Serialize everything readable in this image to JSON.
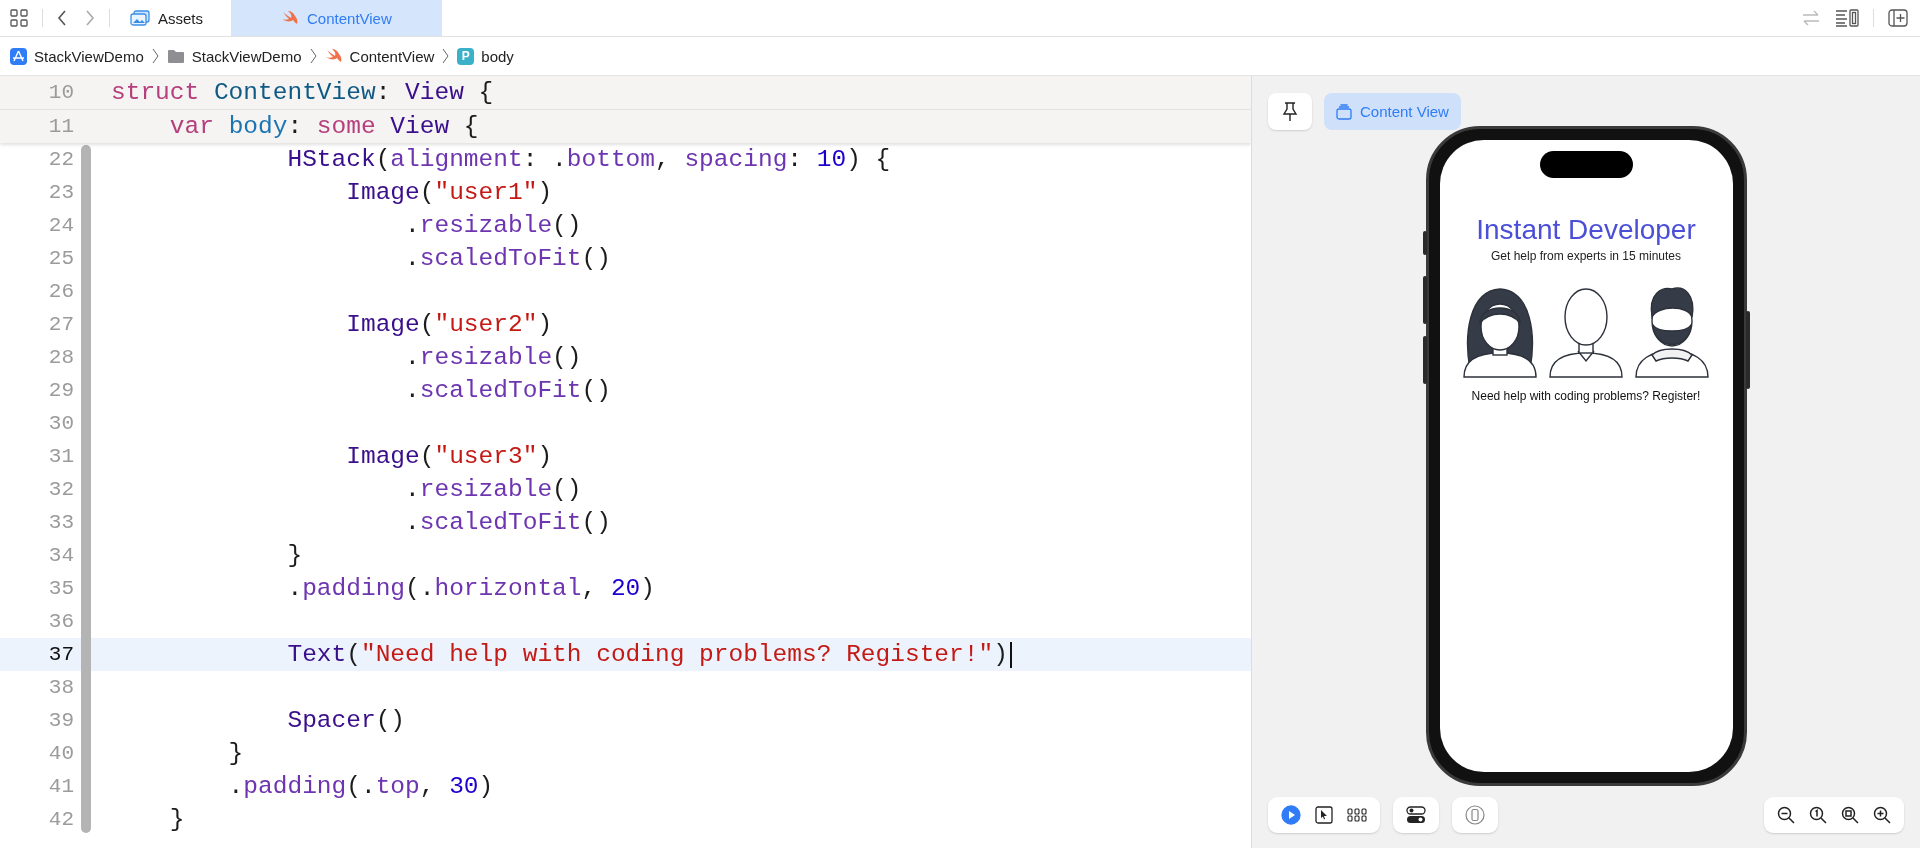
{
  "tab_bar": {
    "tabs": [
      {
        "label": "Assets",
        "selected": false
      },
      {
        "label": "ContentView",
        "selected": true
      }
    ]
  },
  "breadcrumb": [
    {
      "label": "StackViewDemo"
    },
    {
      "label": "StackViewDemo"
    },
    {
      "label": "ContentView"
    },
    {
      "label": "body",
      "badge": "P"
    }
  ],
  "editor": {
    "sticky_lines": [
      {
        "number": "10",
        "tokens": [
          {
            "kind": "kw",
            "text": "struct "
          },
          {
            "kind": "decl",
            "text": "ContentView"
          },
          {
            "kind": "plain",
            "text": ": "
          },
          {
            "kind": "type",
            "text": "View"
          },
          {
            "kind": "plain",
            "text": " {"
          }
        ]
      },
      {
        "number": "11",
        "tokens": [
          {
            "kind": "kw",
            "text": "    var "
          },
          {
            "kind": "var",
            "text": "body"
          },
          {
            "kind": "plain",
            "text": ": "
          },
          {
            "kind": "kw",
            "text": "some "
          },
          {
            "kind": "type",
            "text": "View"
          },
          {
            "kind": "plain",
            "text": " {"
          }
        ]
      }
    ],
    "lines": [
      {
        "number": "22",
        "current": false,
        "tokens": [
          {
            "kind": "type",
            "text": "            HStack"
          },
          {
            "kind": "plain",
            "text": "("
          },
          {
            "kind": "method",
            "text": "alignment"
          },
          {
            "kind": "plain",
            "text": ": ."
          },
          {
            "kind": "method",
            "text": "bottom"
          },
          {
            "kind": "plain",
            "text": ", "
          },
          {
            "kind": "method",
            "text": "spacing"
          },
          {
            "kind": "plain",
            "text": ": "
          },
          {
            "kind": "num",
            "text": "10"
          },
          {
            "kind": "plain",
            "text": ") {"
          }
        ]
      },
      {
        "number": "23",
        "current": false,
        "tokens": [
          {
            "kind": "type",
            "text": "                Image"
          },
          {
            "kind": "plain",
            "text": "("
          },
          {
            "kind": "str",
            "text": "\"user1\""
          },
          {
            "kind": "plain",
            "text": ")"
          }
        ]
      },
      {
        "number": "24",
        "current": false,
        "tokens": [
          {
            "kind": "plain",
            "text": "                    ."
          },
          {
            "kind": "method",
            "text": "resizable"
          },
          {
            "kind": "plain",
            "text": "()"
          }
        ]
      },
      {
        "number": "25",
        "current": false,
        "tokens": [
          {
            "kind": "plain",
            "text": "                    ."
          },
          {
            "kind": "method",
            "text": "scaledToFit"
          },
          {
            "kind": "plain",
            "text": "()"
          }
        ]
      },
      {
        "number": "26",
        "current": false
      },
      {
        "number": "27",
        "current": false,
        "tokens": [
          {
            "kind": "type",
            "text": "                Image"
          },
          {
            "kind": "plain",
            "text": "("
          },
          {
            "kind": "str",
            "text": "\"user2\""
          },
          {
            "kind": "plain",
            "text": ")"
          }
        ]
      },
      {
        "number": "28",
        "current": false,
        "tokens": [
          {
            "kind": "plain",
            "text": "                    ."
          },
          {
            "kind": "method",
            "text": "resizable"
          },
          {
            "kind": "plain",
            "text": "()"
          }
        ]
      },
      {
        "number": "29",
        "current": false,
        "tokens": [
          {
            "kind": "plain",
            "text": "                    ."
          },
          {
            "kind": "method",
            "text": "scaledToFit"
          },
          {
            "kind": "plain",
            "text": "()"
          }
        ]
      },
      {
        "number": "30",
        "current": false
      },
      {
        "number": "31",
        "current": false,
        "tokens": [
          {
            "kind": "type",
            "text": "                Image"
          },
          {
            "kind": "plain",
            "text": "("
          },
          {
            "kind": "str",
            "text": "\"user3\""
          },
          {
            "kind": "plain",
            "text": ")"
          }
        ]
      },
      {
        "number": "32",
        "current": false,
        "tokens": [
          {
            "kind": "plain",
            "text": "                    ."
          },
          {
            "kind": "method",
            "text": "resizable"
          },
          {
            "kind": "plain",
            "text": "()"
          }
        ]
      },
      {
        "number": "33",
        "current": false,
        "tokens": [
          {
            "kind": "plain",
            "text": "                    ."
          },
          {
            "kind": "method",
            "text": "scaledToFit"
          },
          {
            "kind": "plain",
            "text": "()"
          }
        ]
      },
      {
        "number": "34",
        "current": false,
        "tokens": [
          {
            "kind": "plain",
            "text": "            }"
          }
        ]
      },
      {
        "number": "35",
        "current": false,
        "tokens": [
          {
            "kind": "plain",
            "text": "            ."
          },
          {
            "kind": "method",
            "text": "padding"
          },
          {
            "kind": "plain",
            "text": "(."
          },
          {
            "kind": "method",
            "text": "horizontal"
          },
          {
            "kind": "plain",
            "text": ", "
          },
          {
            "kind": "num",
            "text": "20"
          },
          {
            "kind": "plain",
            "text": ")"
          }
        ]
      },
      {
        "number": "36",
        "current": false
      },
      {
        "number": "37",
        "current": true,
        "tokens": [
          {
            "kind": "type",
            "text": "            Text"
          },
          {
            "kind": "plain",
            "text": "("
          },
          {
            "kind": "str",
            "text": "\"Need help with coding problems? Register!\""
          },
          {
            "kind": "plain",
            "text": ")"
          }
        ]
      },
      {
        "number": "38",
        "current": false
      },
      {
        "number": "39",
        "current": false,
        "tokens": [
          {
            "kind": "type",
            "text": "            Spacer"
          },
          {
            "kind": "plain",
            "text": "()"
          }
        ]
      },
      {
        "number": "40",
        "current": false,
        "tokens": [
          {
            "kind": "plain",
            "text": "        }"
          }
        ]
      },
      {
        "number": "41",
        "current": false,
        "tokens": [
          {
            "kind": "plain",
            "text": "        ."
          },
          {
            "kind": "method",
            "text": "padding"
          },
          {
            "kind": "plain",
            "text": "(."
          },
          {
            "kind": "method",
            "text": "top"
          },
          {
            "kind": "plain",
            "text": ", "
          },
          {
            "kind": "num",
            "text": "30"
          },
          {
            "kind": "plain",
            "text": ")"
          }
        ]
      },
      {
        "number": "42",
        "current": false,
        "tokens": [
          {
            "kind": "plain",
            "text": "    }"
          }
        ]
      }
    ]
  },
  "preview": {
    "scheme": {
      "label": "Content View",
      "selected": true
    },
    "app": {
      "title": "Instant Developer",
      "subtitle": "Get help from experts in 15 minutes",
      "caption": "Need help with coding problems? Register!"
    },
    "modes": [
      {
        "kind": "live",
        "selected": true
      },
      {
        "kind": "select",
        "selected": false
      },
      {
        "kind": "variants",
        "selected": false
      }
    ]
  }
}
